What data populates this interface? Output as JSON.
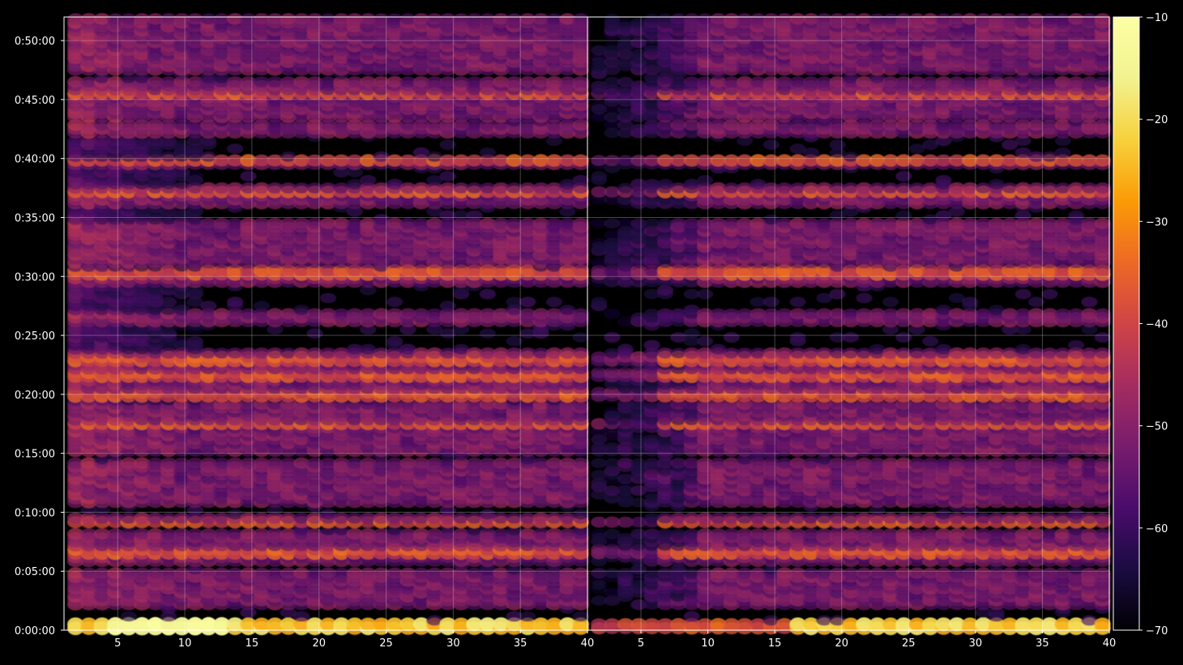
{
  "chart_data": {
    "type": "heatmap",
    "title": "",
    "xlabel": "",
    "ylabel": "",
    "colormap": "inferno",
    "background": "#000000",
    "grid": true,
    "panels": [
      {
        "name": "",
        "x_range": [
          1,
          40
        ],
        "tick_labels": [
          "5",
          "10",
          "15",
          "20",
          "25",
          "30",
          "35",
          "40"
        ]
      },
      {
        "name": "",
        "x_range": [
          1,
          40
        ],
        "tick_labels": [
          "5",
          "10",
          "15",
          "20",
          "25",
          "30",
          "35",
          "40"
        ]
      }
    ],
    "x_ticks": [
      5,
      10,
      15,
      20,
      25,
      30,
      35,
      40
    ],
    "y_range_seconds": [
      0,
      3120
    ],
    "y_ticks_seconds": [
      0,
      300,
      600,
      900,
      1200,
      1500,
      1800,
      2100,
      2400,
      2700,
      3000
    ],
    "y_tick_labels": [
      "0:00:00",
      "0:05:00",
      "0:10:00",
      "0:15:00",
      "0:20:00",
      "0:25:00",
      "0:30:00",
      "0:35:00",
      "0:40:00",
      "0:45:00",
      "0:50:00"
    ],
    "colorbar": {
      "range": [
        -70,
        -10
      ],
      "ticks": [
        -10,
        -20,
        -30,
        -40,
        -50,
        -60,
        -70
      ],
      "tick_labels": [
        "−10",
        "−20",
        "−30",
        "−40",
        "−50",
        "−60",
        "−70"
      ]
    },
    "hot_rows_seconds": [
      20,
      400,
      550,
      1050,
      1200,
      1300,
      1380,
      1820,
      2230,
      2390,
      2730
    ],
    "band_rows_seconds": [
      [
        0,
        40
      ],
      [
        120,
        300
      ],
      [
        350,
        500
      ],
      [
        540,
        580
      ],
      [
        640,
        860
      ],
      [
        900,
        1160
      ],
      [
        1180,
        1420
      ],
      [
        1560,
        1620
      ],
      [
        1760,
        1840
      ],
      [
        1870,
        2080
      ],
      [
        2160,
        2190
      ],
      [
        2210,
        2260
      ],
      [
        2360,
        2400
      ],
      [
        2520,
        2570
      ],
      [
        2600,
        2800
      ],
      [
        2850,
        3120
      ]
    ],
    "value_levels": {
      "background": -70,
      "band_typical": -52,
      "hot_row_typical": -38,
      "peak_bottom_row": -15,
      "peak_secondary": -22
    }
  }
}
